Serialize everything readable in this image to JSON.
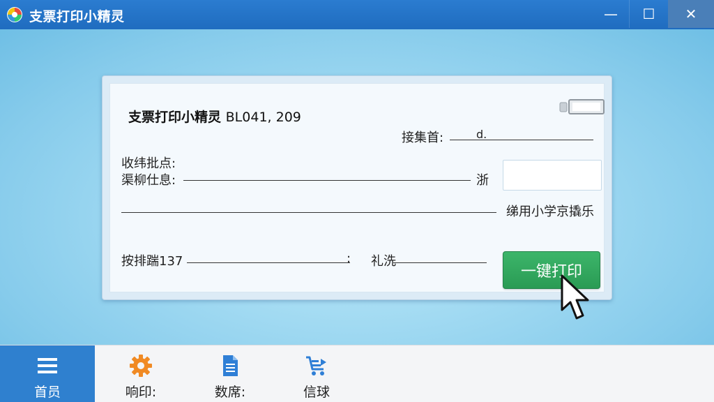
{
  "window": {
    "title": "支票打印小精灵",
    "minimize_glyph": "—",
    "maximize_glyph": "☐",
    "close_glyph": "✕"
  },
  "cheque": {
    "title": "支票打印小精灵",
    "serial": "BL041, 209",
    "date_label": "接集首:",
    "date_value": "d.",
    "payee_label_1": "收纬批点:",
    "payee_label_2": "渠柳仕息:",
    "amount_label": "浙",
    "memo_right": "绨用小学京撬乐",
    "account_label": "按排踹137",
    "account_colon": ":",
    "purpose_label": "礼洗",
    "print_button": "一键打印"
  },
  "bottom_nav": {
    "items": [
      {
        "label": "首员",
        "icon": "menu-icon"
      },
      {
        "label": "响印:",
        "icon": "gear-icon"
      },
      {
        "label": "数席:",
        "icon": "document-icon"
      },
      {
        "label": "信球",
        "icon": "cart-icon"
      }
    ]
  },
  "colors": {
    "titlebar": "#2374c7",
    "nav_active": "#2f80cf",
    "print_button": "#33a961",
    "gear": "#f08a24",
    "doc": "#2f7fd6"
  }
}
